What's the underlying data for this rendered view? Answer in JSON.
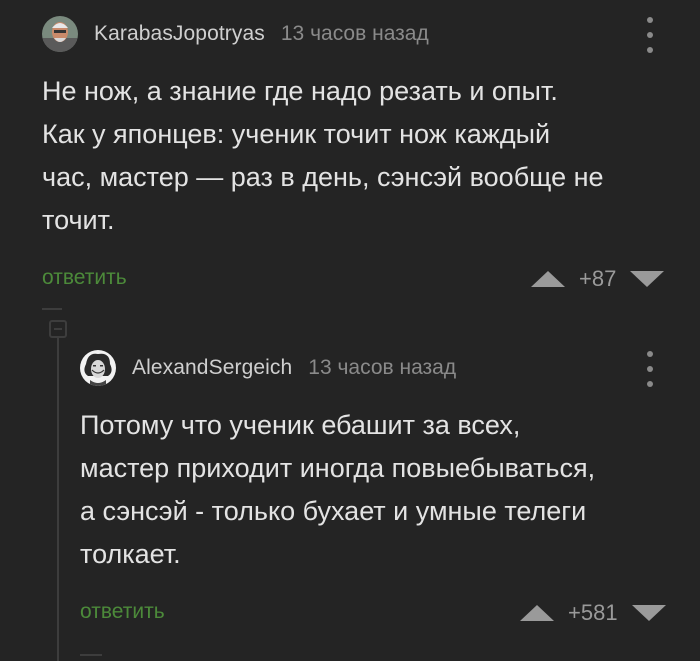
{
  "comments": [
    {
      "username": "KarabasJopotryas",
      "time": "13 часов назад",
      "text": "Не нож, а знание где надо резать и опыт.\nКак у японцев: ученик точит нож каждый\nчас, мастер — раз в день, сэнсэй вообще не\nточит.",
      "reply_label": "ответить",
      "score": "+87"
    },
    {
      "username": "AlexandSergeich",
      "time": "13 часов назад",
      "text": "Потому что ученик ебашит за всех,\nмастер приходит иногда повыебываться,\nа сэнсэй - только бухает и умные телеги\nтолкает.",
      "reply_label": "ответить",
      "score": "+581"
    }
  ],
  "colors": {
    "background": "#242424",
    "text": "#e3e3e3",
    "username": "#cfcfcf",
    "muted": "#8a8a8a",
    "reply_link": "#4c8a3a"
  },
  "icons": [
    "avatar",
    "kebab-menu-icon",
    "upvote-icon",
    "downvote-icon",
    "collapse-thread-icon"
  ]
}
